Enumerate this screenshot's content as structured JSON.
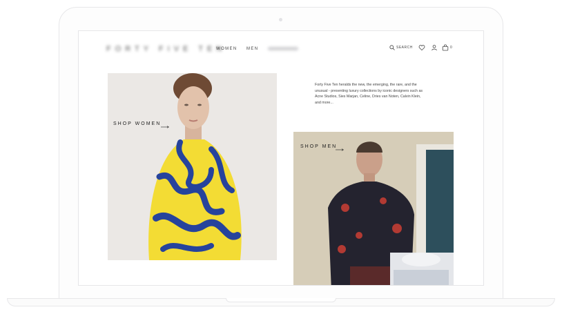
{
  "brand": {
    "logo_text": "FORTY FIVE TEN"
  },
  "nav": {
    "women_label": "WOMEN",
    "men_label": "MEN"
  },
  "header": {
    "search_label": "SEARCH",
    "cart_count": "0"
  },
  "intro": {
    "text": "Forty Five Ten heralds the new, the emerging, the rare, and the unusual - presenting luxury collections by iconic designers such as Acne Studios, Sies Marjan, Celine, Dries van Noten, Calvin Klein, and more..."
  },
  "tiles": {
    "women_label": "SHOP WOMEN",
    "men_label": "SHOP MEN"
  },
  "icons": [
    "search-icon",
    "heart-icon",
    "user-icon",
    "bag-icon",
    "arrow-right-icon"
  ]
}
